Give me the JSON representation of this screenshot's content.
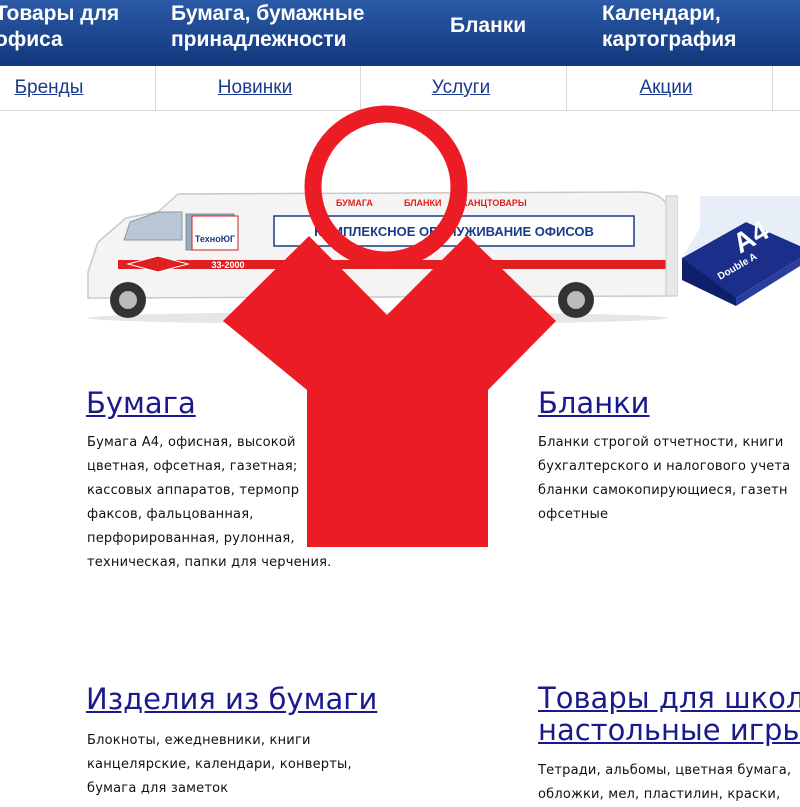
{
  "topnav": {
    "cat1": "Товары для офиса",
    "cat2": "Бумага, бумажные принадлежности",
    "cat3": "Бланки",
    "cat4": "Календари, картография"
  },
  "subnav": {
    "items": [
      "Бренды",
      "Новинки",
      "Услуги",
      "Акции"
    ]
  },
  "banner": {
    "van_tags": [
      "БУМАГА",
      "БЛАНКИ",
      "КАНЦТОВАРЫ"
    ],
    "van_slogan": "КОМПЛЕКСНОЕ ОБСЛУЖИВАНИЕ ОФИСОВ",
    "van_brand": "ТехноЮГ",
    "van_phone": "33-2000",
    "paper_brand": "Double A",
    "paper_size": "A4"
  },
  "sections": [
    {
      "title": "Бумага",
      "lines": [
        "Бумага А4, офисная, высокой",
        "цветная, офсетная, газетная;",
        "кассовых аппаратов, термопр",
        "факсов, фальцованная,",
        "перфорированная, рулонная,",
        "техническая, папки для черчения."
      ]
    },
    {
      "title": "Бланки",
      "lines": [
        "Бланки строгой отчетности, книги",
        "бухгалтерского и налогового учета",
        "бланки самокопирующиеся, газетн",
        "офсетные"
      ]
    },
    {
      "title": "Изделия из бумаги",
      "lines": [
        "Блокноты, ежедневники, книги",
        "канцелярские, календари, конверты,",
        "бумага для заметок"
      ]
    },
    {
      "title_line1": "Товары для школ",
      "title_line2": "настольные игры",
      "lines": [
        "Тетради, альбомы, цветная бумага,",
        "обложки, мел, пластилин, краски,"
      ]
    }
  ],
  "colors": {
    "topnav_blue": "#1e4a96",
    "link_blue": "#1a1a8c",
    "overlay_red": "#ec1c24",
    "van_red": "#e02020"
  }
}
